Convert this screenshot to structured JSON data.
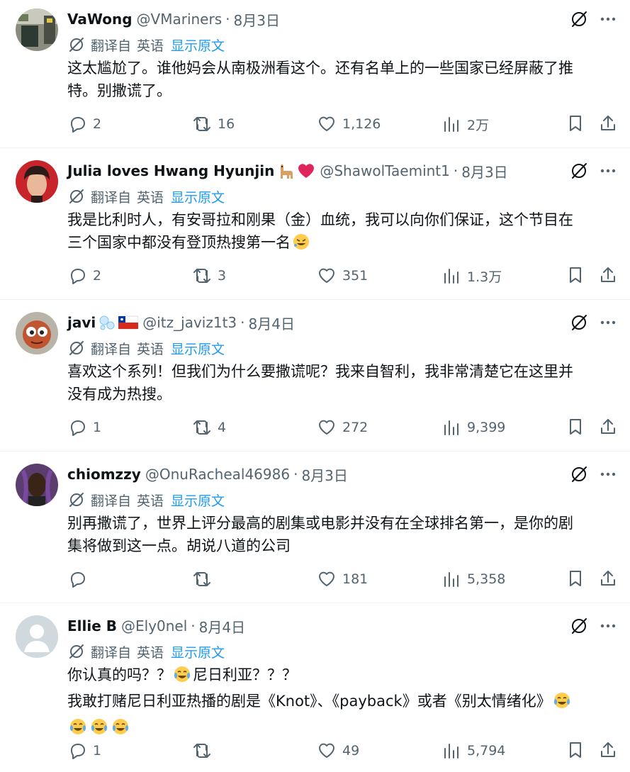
{
  "translate": {
    "prefix": "翻译自",
    "lang": "英语",
    "show_original": "显示原文"
  },
  "tweets": [
    {
      "name": "VaWong",
      "handle": "@VMariners",
      "dot": "·",
      "date": "8月3日",
      "lines": [
        "这太尴尬了。谁他妈会从南极洲看这个。还有名单上的一些国家已经屏蔽了推",
        "特。别撒谎了。"
      ],
      "replies": "2",
      "reposts": "16",
      "likes": "1,126",
      "views": "2万"
    },
    {
      "name": "Julia loves Hwang Hyunjin",
      "name_emojis": [
        "llama-emoji",
        "red-heart-emoji"
      ],
      "handle": "@ShawolTaemint1",
      "dot": "·",
      "date": "8月3日",
      "lines": [
        "我是比利时人，有安哥拉和刚果（金）血统，我可以向你们保证，这个节目在",
        "三个国家中都没有登顶热搜第一名"
      ],
      "replies": "2",
      "reposts": "3",
      "likes": "351",
      "views": "1.3万"
    },
    {
      "name": "javi",
      "name_emojis": [
        "bubbles-emoji",
        "chile-flag-emoji"
      ],
      "handle": "@itz_javiz1t3",
      "dot": "·",
      "date": "8月4日",
      "lines": [
        "喜欢这个系列！但我们为什么要撒谎呢？我来自智利，我非常清楚它在这里并",
        "没有成为热搜。"
      ],
      "replies": "1",
      "reposts": "4",
      "likes": "272",
      "views": "9,399"
    },
    {
      "name": "chiomzzy",
      "handle": "@OnuRacheal46986",
      "dot": "·",
      "date": "8月3日",
      "lines": [
        "别再撒谎了，世界上评分最高的剧集或电影并没有在全球排名第一，是你的剧",
        "集将做到这一点。胡说八道的公司"
      ],
      "replies": "",
      "reposts": "",
      "likes": "181",
      "views": "5,358"
    },
    {
      "name": "Ellie B",
      "handle": "@Ely0nel",
      "dot": "·",
      "date": "8月4日",
      "line1a": "你认真的吗？？",
      "line1b": "尼日利亚？？？",
      "line2": "我敢打赌尼日利亚热播的剧是《Knot》、《payback》或者《别太情绪化》",
      "replies": "1",
      "reposts": "",
      "likes": "49",
      "views": "5,794"
    }
  ]
}
